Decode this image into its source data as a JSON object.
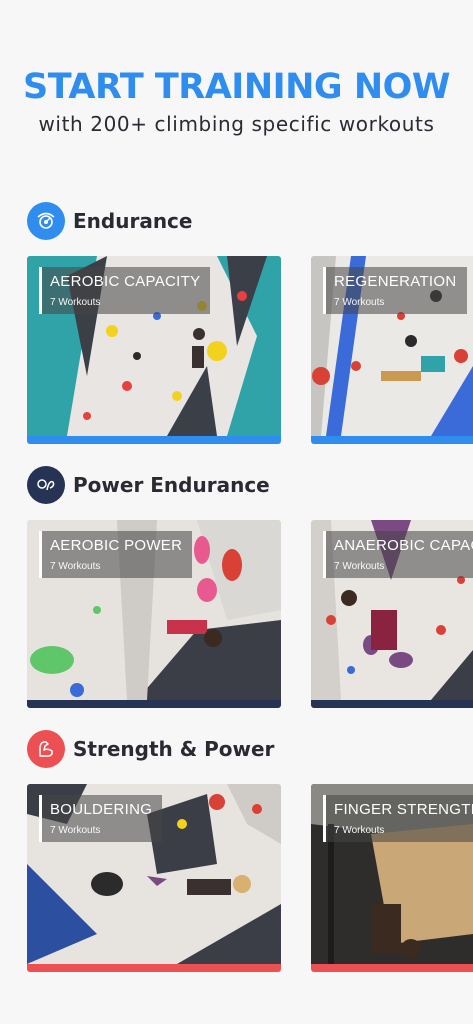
{
  "hero": {
    "title": "START TRAINING NOW",
    "subtitle": "with 200+ climbing specific workouts"
  },
  "sections": [
    {
      "title": "Endurance",
      "icon": "endurance-gauge-icon",
      "color": "#2f8df0",
      "cards": [
        {
          "title": "AEROBIC CAPACITY",
          "count": "7 Workouts"
        },
        {
          "title": "REGENERATION",
          "count": "7 Workouts"
        }
      ]
    },
    {
      "title": "Power Endurance",
      "icon": "power-endurance-icon",
      "color": "#263354",
      "cards": [
        {
          "title": "AEROBIC POWER",
          "count": "7 Workouts"
        },
        {
          "title": "ANAEROBIC CAPACITY",
          "count": "7 Workouts"
        }
      ]
    },
    {
      "title": "Strength & Power",
      "icon": "flexed-arm-icon",
      "color": "#ec5052",
      "cards": [
        {
          "title": "BOULDERING",
          "count": "7 Workouts"
        },
        {
          "title": "FINGER STRENGTH",
          "count": "7 Workouts"
        }
      ]
    }
  ]
}
